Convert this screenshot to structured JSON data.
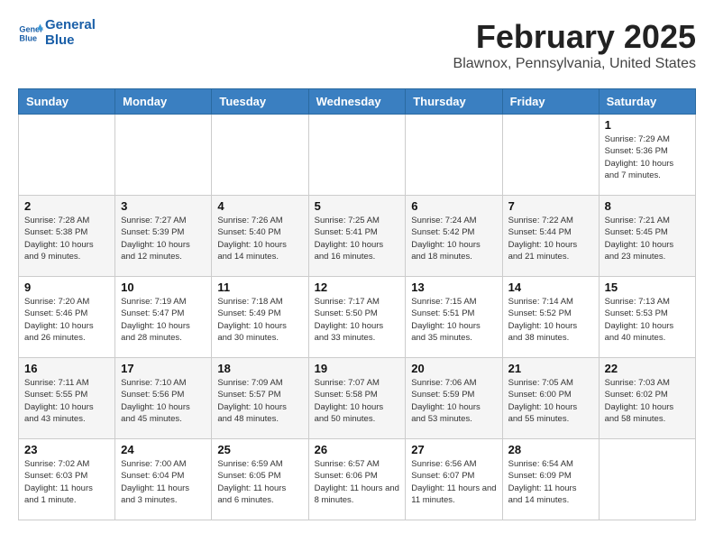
{
  "header": {
    "logo_line1": "General",
    "logo_line2": "Blue",
    "month": "February 2025",
    "location": "Blawnox, Pennsylvania, United States"
  },
  "weekdays": [
    "Sunday",
    "Monday",
    "Tuesday",
    "Wednesday",
    "Thursday",
    "Friday",
    "Saturday"
  ],
  "weeks": [
    [
      {
        "day": "",
        "info": ""
      },
      {
        "day": "",
        "info": ""
      },
      {
        "day": "",
        "info": ""
      },
      {
        "day": "",
        "info": ""
      },
      {
        "day": "",
        "info": ""
      },
      {
        "day": "",
        "info": ""
      },
      {
        "day": "1",
        "info": "Sunrise: 7:29 AM\nSunset: 5:36 PM\nDaylight: 10 hours and 7 minutes."
      }
    ],
    [
      {
        "day": "2",
        "info": "Sunrise: 7:28 AM\nSunset: 5:38 PM\nDaylight: 10 hours and 9 minutes."
      },
      {
        "day": "3",
        "info": "Sunrise: 7:27 AM\nSunset: 5:39 PM\nDaylight: 10 hours and 12 minutes."
      },
      {
        "day": "4",
        "info": "Sunrise: 7:26 AM\nSunset: 5:40 PM\nDaylight: 10 hours and 14 minutes."
      },
      {
        "day": "5",
        "info": "Sunrise: 7:25 AM\nSunset: 5:41 PM\nDaylight: 10 hours and 16 minutes."
      },
      {
        "day": "6",
        "info": "Sunrise: 7:24 AM\nSunset: 5:42 PM\nDaylight: 10 hours and 18 minutes."
      },
      {
        "day": "7",
        "info": "Sunrise: 7:22 AM\nSunset: 5:44 PM\nDaylight: 10 hours and 21 minutes."
      },
      {
        "day": "8",
        "info": "Sunrise: 7:21 AM\nSunset: 5:45 PM\nDaylight: 10 hours and 23 minutes."
      }
    ],
    [
      {
        "day": "9",
        "info": "Sunrise: 7:20 AM\nSunset: 5:46 PM\nDaylight: 10 hours and 26 minutes."
      },
      {
        "day": "10",
        "info": "Sunrise: 7:19 AM\nSunset: 5:47 PM\nDaylight: 10 hours and 28 minutes."
      },
      {
        "day": "11",
        "info": "Sunrise: 7:18 AM\nSunset: 5:49 PM\nDaylight: 10 hours and 30 minutes."
      },
      {
        "day": "12",
        "info": "Sunrise: 7:17 AM\nSunset: 5:50 PM\nDaylight: 10 hours and 33 minutes."
      },
      {
        "day": "13",
        "info": "Sunrise: 7:15 AM\nSunset: 5:51 PM\nDaylight: 10 hours and 35 minutes."
      },
      {
        "day": "14",
        "info": "Sunrise: 7:14 AM\nSunset: 5:52 PM\nDaylight: 10 hours and 38 minutes."
      },
      {
        "day": "15",
        "info": "Sunrise: 7:13 AM\nSunset: 5:53 PM\nDaylight: 10 hours and 40 minutes."
      }
    ],
    [
      {
        "day": "16",
        "info": "Sunrise: 7:11 AM\nSunset: 5:55 PM\nDaylight: 10 hours and 43 minutes."
      },
      {
        "day": "17",
        "info": "Sunrise: 7:10 AM\nSunset: 5:56 PM\nDaylight: 10 hours and 45 minutes."
      },
      {
        "day": "18",
        "info": "Sunrise: 7:09 AM\nSunset: 5:57 PM\nDaylight: 10 hours and 48 minutes."
      },
      {
        "day": "19",
        "info": "Sunrise: 7:07 AM\nSunset: 5:58 PM\nDaylight: 10 hours and 50 minutes."
      },
      {
        "day": "20",
        "info": "Sunrise: 7:06 AM\nSunset: 5:59 PM\nDaylight: 10 hours and 53 minutes."
      },
      {
        "day": "21",
        "info": "Sunrise: 7:05 AM\nSunset: 6:00 PM\nDaylight: 10 hours and 55 minutes."
      },
      {
        "day": "22",
        "info": "Sunrise: 7:03 AM\nSunset: 6:02 PM\nDaylight: 10 hours and 58 minutes."
      }
    ],
    [
      {
        "day": "23",
        "info": "Sunrise: 7:02 AM\nSunset: 6:03 PM\nDaylight: 11 hours and 1 minute."
      },
      {
        "day": "24",
        "info": "Sunrise: 7:00 AM\nSunset: 6:04 PM\nDaylight: 11 hours and 3 minutes."
      },
      {
        "day": "25",
        "info": "Sunrise: 6:59 AM\nSunset: 6:05 PM\nDaylight: 11 hours and 6 minutes."
      },
      {
        "day": "26",
        "info": "Sunrise: 6:57 AM\nSunset: 6:06 PM\nDaylight: 11 hours and 8 minutes."
      },
      {
        "day": "27",
        "info": "Sunrise: 6:56 AM\nSunset: 6:07 PM\nDaylight: 11 hours and 11 minutes."
      },
      {
        "day": "28",
        "info": "Sunrise: 6:54 AM\nSunset: 6:09 PM\nDaylight: 11 hours and 14 minutes."
      },
      {
        "day": "",
        "info": ""
      }
    ]
  ]
}
